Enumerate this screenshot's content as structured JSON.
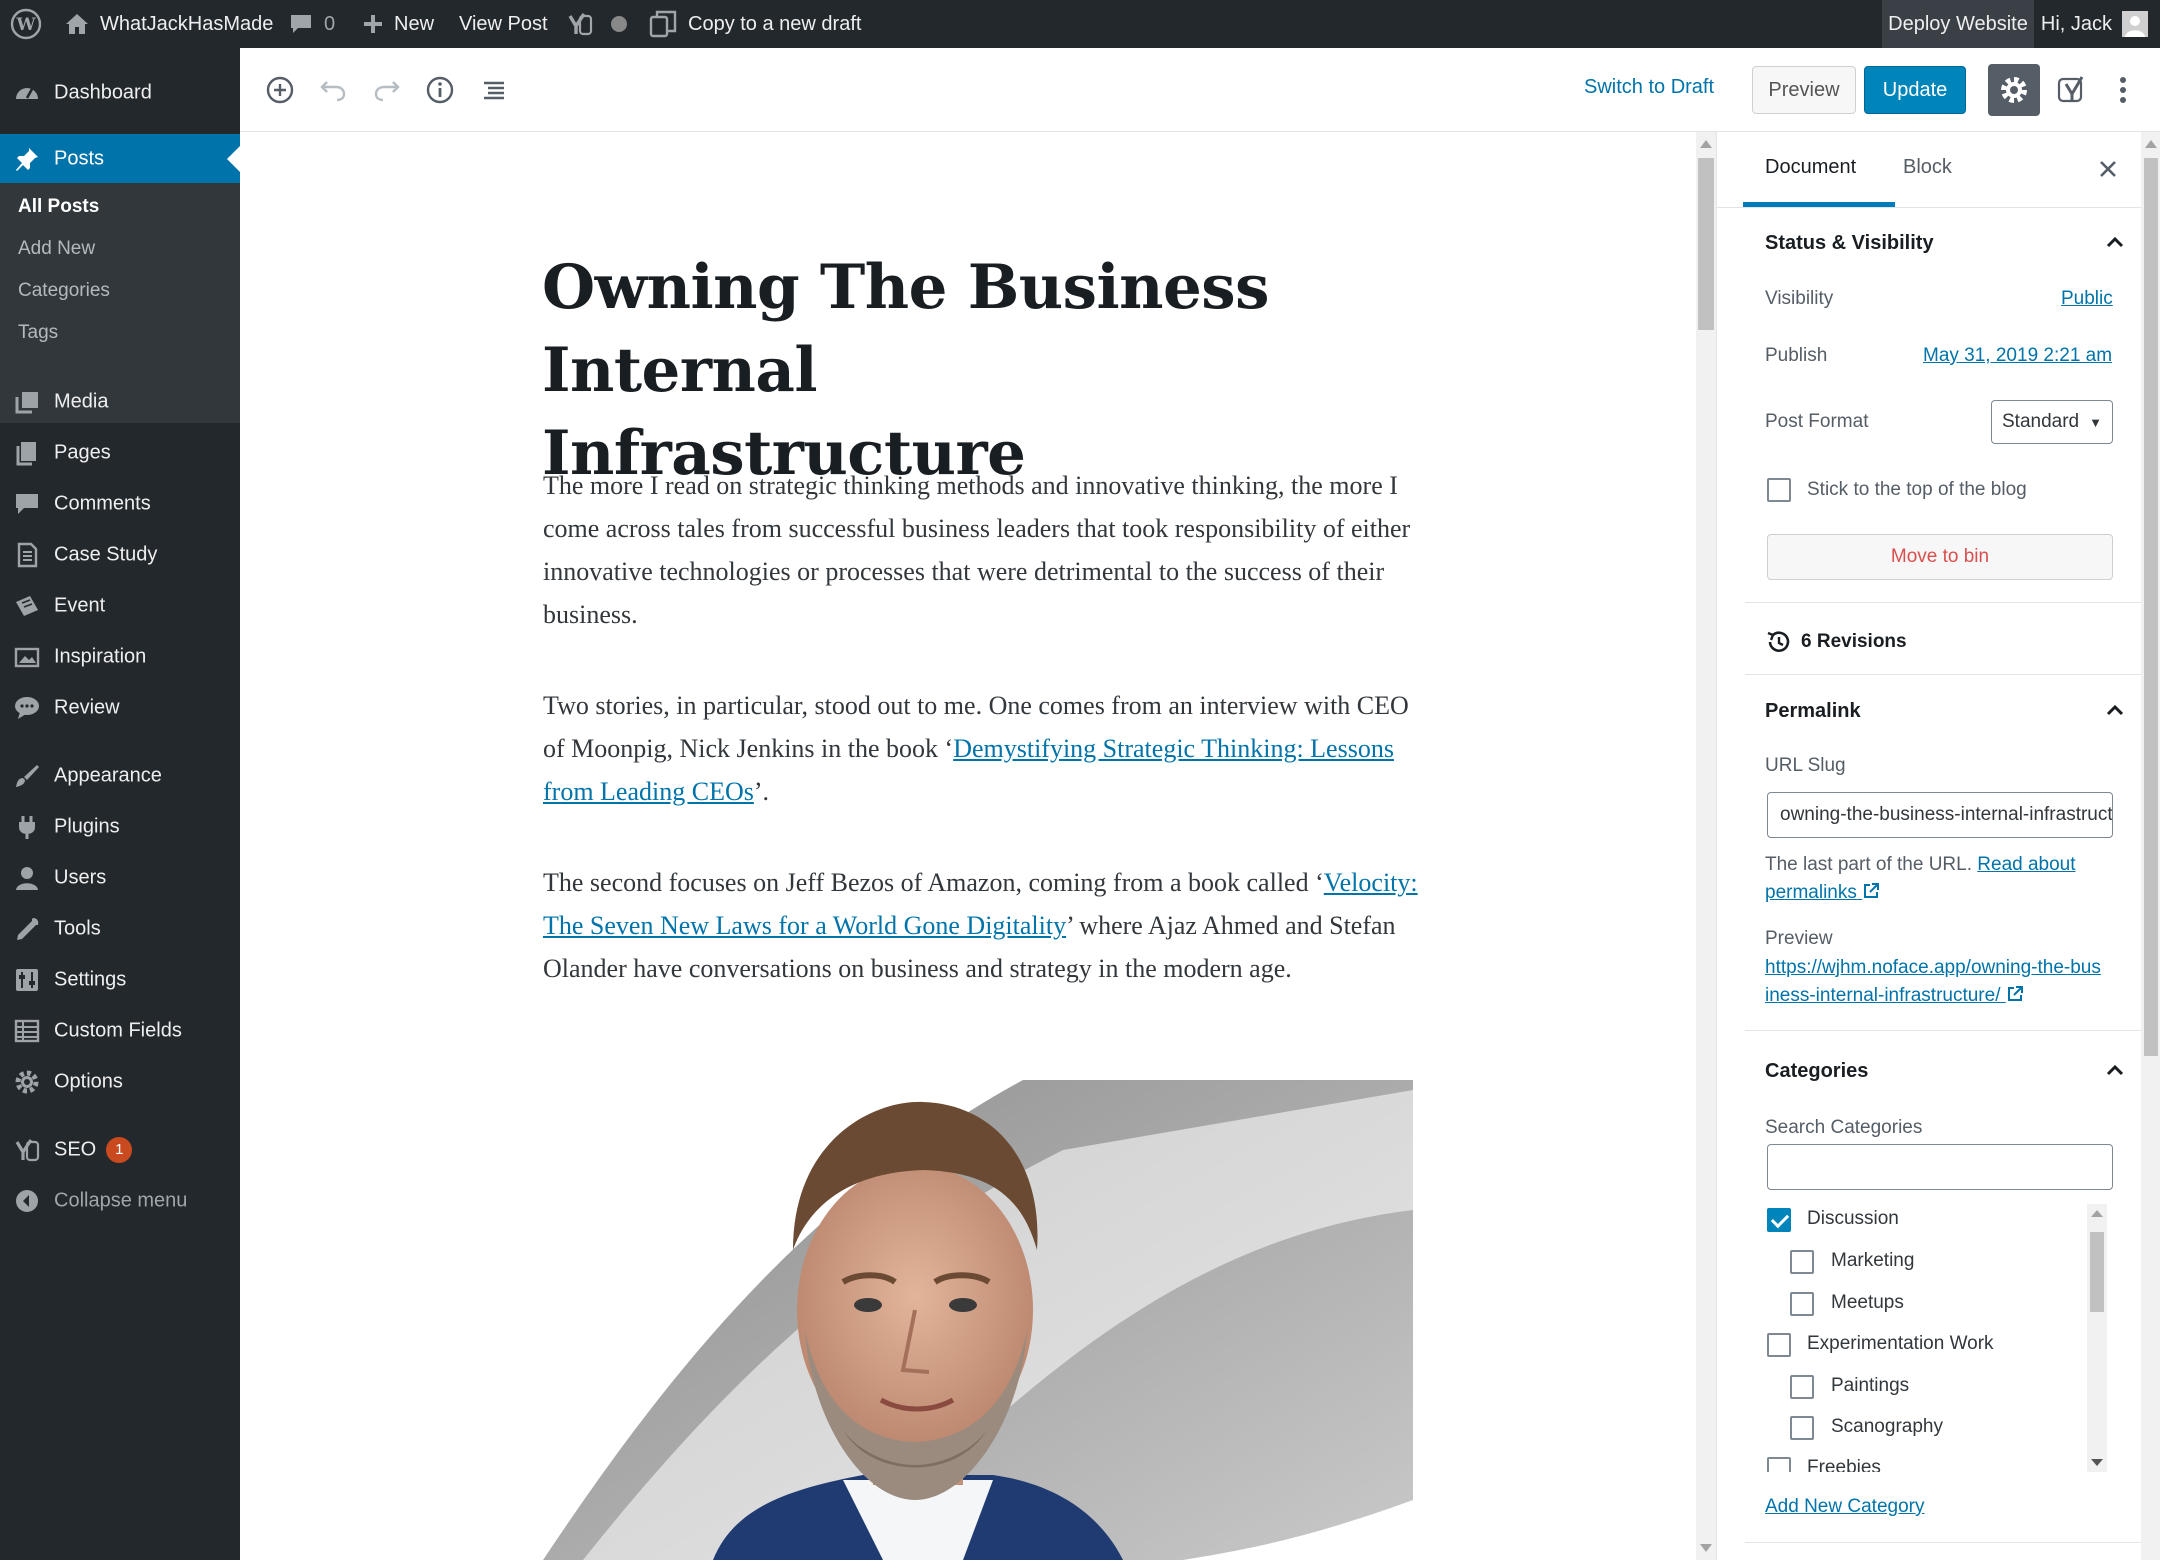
{
  "adminbar": {
    "site_name": "WhatJackHasMade",
    "comments_count": "0",
    "new_label": "New",
    "view_post_label": "View Post",
    "copy_draft_label": "Copy to a new draft",
    "deploy_label": "Deploy Website",
    "greeting": "Hi, Jack"
  },
  "menu": {
    "dashboard": "Dashboard",
    "posts": "Posts",
    "posts_sub": [
      "All Posts",
      "Add New",
      "Categories",
      "Tags"
    ],
    "media": "Media",
    "pages": "Pages",
    "comments": "Comments",
    "case_study": "Case Study",
    "event": "Event",
    "inspiration": "Inspiration",
    "review": "Review",
    "appearance": "Appearance",
    "plugins": "Plugins",
    "users": "Users",
    "tools": "Tools",
    "settings": "Settings",
    "custom_fields": "Custom Fields",
    "options": "Options",
    "seo": "SEO",
    "seo_badge": "1",
    "collapse": "Collapse menu"
  },
  "header": {
    "switch_draft": "Switch to Draft",
    "preview": "Preview",
    "update": "Update"
  },
  "post": {
    "title": "Owning The Business Internal Infrastructure",
    "p1": "The more I read on strategic thinking methods and innovative thinking, the more I come across tales from successful business leaders that took responsibility of either innovative technologies or processes that were detrimental to the success of their business.",
    "p2_before": "Two stories, in particular, stood out to me. One comes from an interview with CEO of Moonpig, Nick Jenkins in the book ‘",
    "p2_link": "Demystifying Strategic Thinking: Lessons from Leading CEOs",
    "p2_after": "’.",
    "p3_before": "The second focuses on Jeff Bezos of Amazon, coming from a book called ‘",
    "p3_link": "Velocity: The Seven New Laws for a World Gone Digitality",
    "p3_after": "’ where Ajaz Ahmed and Stefan Olander have conversations on business and strategy in the modern age."
  },
  "sidebar": {
    "tab_document": "Document",
    "tab_block": "Block",
    "status_title": "Status & Visibility",
    "visibility_label": "Visibility",
    "visibility_value": "Public",
    "publish_label": "Publish",
    "publish_value": "May 31, 2019 2:21 am",
    "format_label": "Post Format",
    "format_value": "Standard",
    "sticky_label": "Stick to the top of the blog",
    "bin_label": "Move to bin",
    "revisions": "6 Revisions",
    "permalink_title": "Permalink",
    "slug_label": "URL Slug",
    "slug_value": "owning-the-business-internal-infrastructure",
    "slug_help": "The last part of the URL.",
    "slug_help_link": "Read about permalinks",
    "preview_label": "Preview",
    "preview_url": "https://wjhm.noface.app/owning-the-business-internal-infrastructure/",
    "categories_title": "Categories",
    "search_categories_label": "Search Categories",
    "categories": [
      {
        "name": "Discussion",
        "checked": true,
        "level": 0
      },
      {
        "name": "Marketing",
        "checked": false,
        "level": 1
      },
      {
        "name": "Meetups",
        "checked": false,
        "level": 1
      },
      {
        "name": "Experimentation Work",
        "checked": false,
        "level": 0
      },
      {
        "name": "Paintings",
        "checked": false,
        "level": 1
      },
      {
        "name": "Scanography",
        "checked": false,
        "level": 1
      },
      {
        "name": "Freebies",
        "checked": false,
        "level": 0
      }
    ],
    "add_category": "Add New Category"
  },
  "colors": {
    "admin_dark": "#23282d",
    "accent_blue": "#0073aa",
    "update_blue": "#0085ba",
    "bin_red": "#d94f4f"
  }
}
